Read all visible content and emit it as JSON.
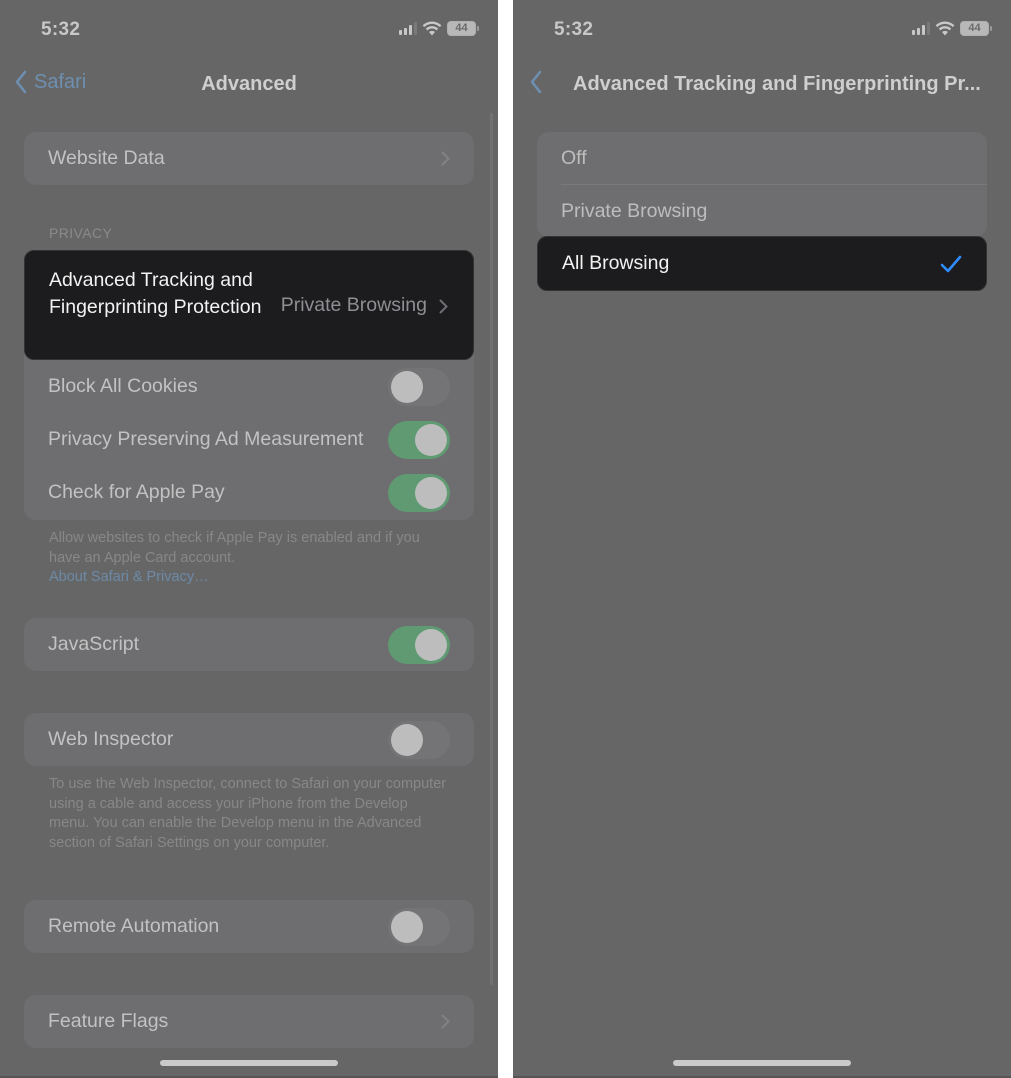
{
  "left": {
    "status": {
      "time": "5:32",
      "battery": "44"
    },
    "nav": {
      "back_label": "Safari",
      "title": "Advanced"
    },
    "website_data": {
      "label": "Website Data"
    },
    "privacy": {
      "header": "PRIVACY",
      "tracking": {
        "label": "Advanced Tracking and Fingerprinting Protection",
        "value": "Private Browsing"
      },
      "toggles": [
        {
          "label": "Block All Cookies",
          "on": false
        },
        {
          "label": "Privacy Preserving Ad Measurement",
          "on": true
        },
        {
          "label": "Check for Apple Pay",
          "on": true
        }
      ],
      "footer": "Allow websites to check if Apple Pay is enabled and if you have an Apple Card account.",
      "footer_link": "About Safari & Privacy…"
    },
    "javascript": {
      "label": "JavaScript",
      "on": true
    },
    "web_inspector": {
      "label": "Web Inspector",
      "on": false,
      "footer": "To use the Web Inspector, connect to Safari on your computer using a cable and access your iPhone from the Develop menu. You can enable the Develop menu in the Advanced section of Safari Settings on your computer."
    },
    "remote_automation": {
      "label": "Remote Automation",
      "on": false
    },
    "feature_flags": {
      "label": "Feature Flags"
    }
  },
  "right": {
    "status": {
      "time": "5:32",
      "battery": "44"
    },
    "nav": {
      "title": "Advanced Tracking and Fingerprinting Pr..."
    },
    "options": [
      {
        "label": "Off"
      },
      {
        "label": "Private Browsing"
      },
      {
        "label": "All Browsing"
      }
    ],
    "selected_index": 2
  },
  "colors": {
    "accent_blue": "#2f8cff",
    "toggle_on": "#5f9a72",
    "highlight_bg": "#1c1c1e"
  }
}
